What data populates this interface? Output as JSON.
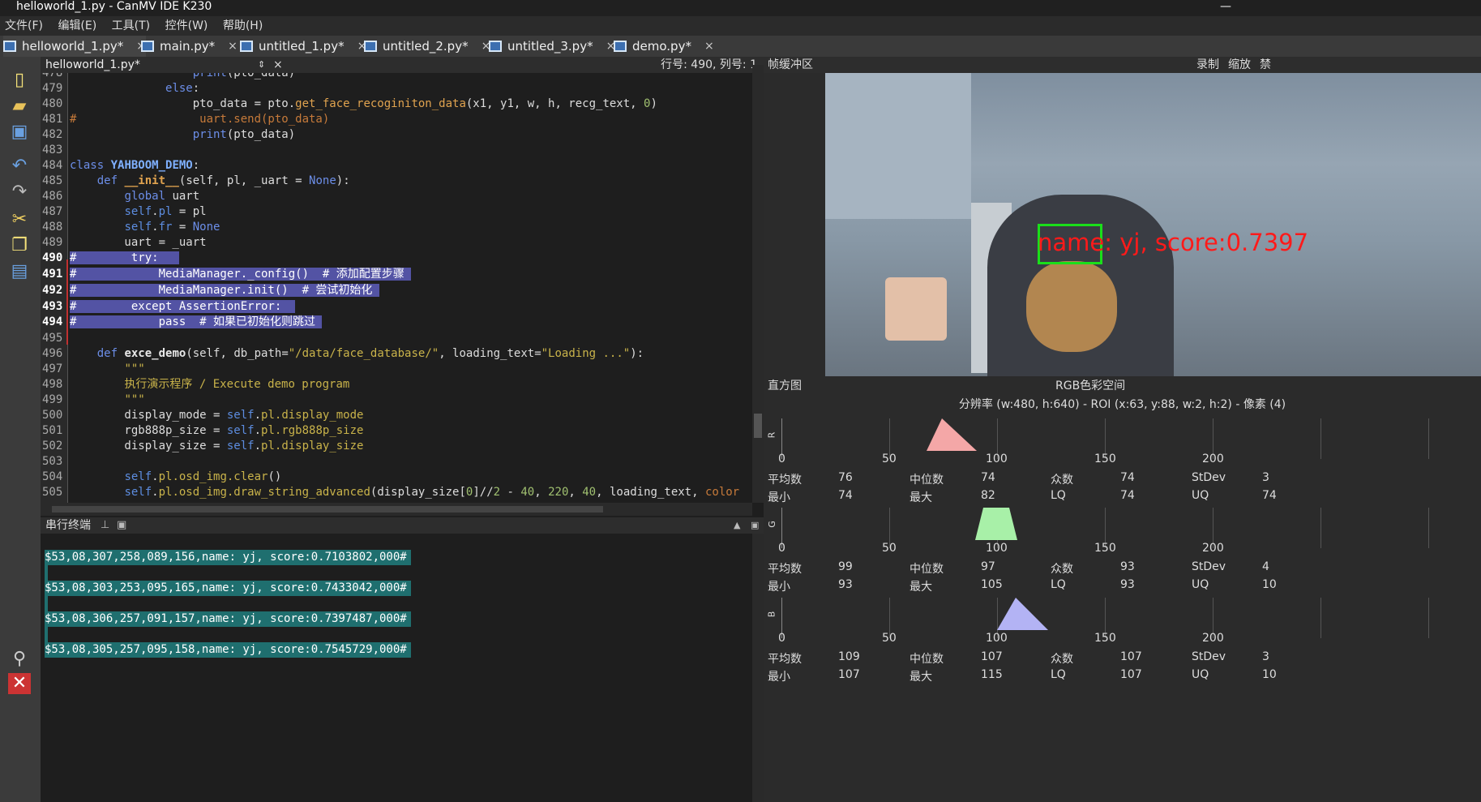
{
  "window": {
    "title": "helloworld_1.py - CanMV IDE K230",
    "minimize": "—"
  },
  "menu": [
    "文件(F)",
    "编辑(E)",
    "工具(T)",
    "控件(W)",
    "帮助(H)"
  ],
  "tabs": [
    {
      "label": "helloworld_1.py*",
      "close": "×"
    },
    {
      "label": "main.py*",
      "close": "×"
    },
    {
      "label": "untitled_1.py*",
      "close": "×"
    },
    {
      "label": "untitled_2.py*",
      "close": "×"
    },
    {
      "label": "untitled_3.py*",
      "close": "×"
    },
    {
      "label": "demo.py*",
      "close": "×"
    }
  ],
  "editor": {
    "filename": "helloworld_1.py*",
    "arrows": "⇕",
    "close": "×",
    "position": "行号: 490, 列号: 1"
  },
  "terminal": {
    "title": "串行终端",
    "lines": [
      "$53,08,307,258,089,156,name: yj, score:0.7103802,000#",
      "$53,08,303,253,095,165,name: yj, score:0.7433042,000#",
      "$53,08,306,257,091,157,name: yj, score:0.7397487,000#",
      "$53,08,305,257,095,158,name: yj, score:0.7545729,000#"
    ]
  },
  "framebuffer": {
    "title": "帧缓冲区",
    "record": "录制",
    "zoom": "缩放",
    "disable": "禁",
    "overlay": "name: yj, score:0.7397"
  },
  "histogram": {
    "title": "直方图",
    "space": "RGB色彩空间",
    "resolution": "分辨率 (w:480, h:640) - ROI (x:63, y:88, w:2, h:2) - 像素 (4)",
    "ticks": [
      "0",
      "50",
      "100",
      "150",
      "200"
    ],
    "labels": {
      "mean": "平均数",
      "median": "中位数",
      "mode": "众数",
      "stdev": "StDev",
      "min": "最小",
      "max": "最大",
      "lq": "LQ",
      "uq": "UQ"
    },
    "channels": [
      {
        "name": "R",
        "color": "#f4a7a7",
        "mean": "76",
        "median": "74",
        "mode": "74",
        "stdev": "3",
        "min": "74",
        "max": "82",
        "lq": "74",
        "uq": "74"
      },
      {
        "name": "G",
        "color": "#a8f0a8",
        "mean": "99",
        "median": "97",
        "mode": "93",
        "stdev": "4",
        "min": "93",
        "max": "105",
        "lq": "93",
        "uq": "10"
      },
      {
        "name": "B",
        "color": "#b3b3f4",
        "mean": "109",
        "median": "107",
        "mode": "107",
        "stdev": "3",
        "min": "107",
        "max": "115",
        "lq": "107",
        "uq": "10"
      }
    ]
  }
}
